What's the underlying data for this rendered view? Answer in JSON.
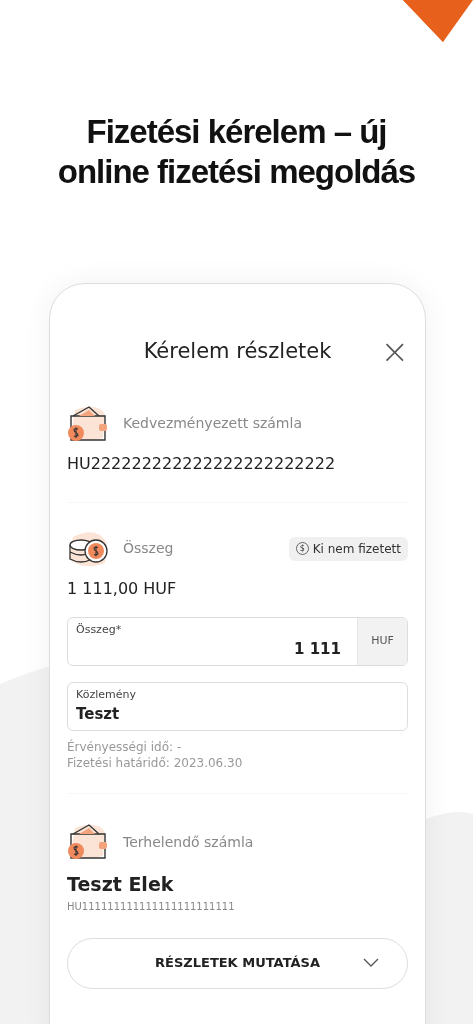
{
  "headline": "Fizetési kérelem – új online fizetési megoldás",
  "screen": {
    "title": "Kérelem részletek",
    "close": "×",
    "beneficiary": {
      "label": "Kedvezményezett számla",
      "account": "HU222222222222222222222222"
    },
    "amount": {
      "label": "Összeg",
      "status": "Ki nem fizetett",
      "status_icon": "$",
      "value": "1 111,00 HUF"
    },
    "amount_field": {
      "label": "Összeg*",
      "value": "1 111",
      "currency": "HUF"
    },
    "message_field": {
      "label": "Közlemény",
      "value": "Teszt"
    },
    "notes": [
      "Érvényességi idő: -",
      "Fizetési határidő: 2023.06.30"
    ],
    "debit": {
      "label": "Terhelendő számla",
      "name": "Teszt Elek",
      "account": "HU111111111111111111111111"
    },
    "details_button": {
      "label": "RÉSZLETEK MUTATÁSA",
      "expanded": false
    }
  }
}
